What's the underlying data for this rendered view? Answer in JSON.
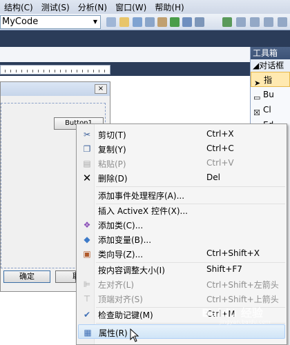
{
  "menubar": {
    "items": [
      "结构(C)",
      "测试(S)",
      "分析(N)",
      "窗口(W)",
      "帮助(H)"
    ]
  },
  "toolbar": {
    "combo_value": "MyCode"
  },
  "toolbox": {
    "title": "工具箱",
    "group": "对话框",
    "items": [
      "指",
      "Bu",
      "Cl",
      "Ed"
    ]
  },
  "dialog": {
    "button1": "Button1",
    "ok": "确定",
    "cancel": "取"
  },
  "context_menu": {
    "items": [
      {
        "label": "剪切(T)",
        "shortcut": "Ctrl+X",
        "icon": "scissors-icon",
        "disabled": false
      },
      {
        "label": "复制(Y)",
        "shortcut": "Ctrl+C",
        "icon": "copy-icon",
        "disabled": false
      },
      {
        "label": "粘贴(P)",
        "shortcut": "Ctrl+V",
        "icon": "paste-icon",
        "disabled": true
      },
      {
        "label": "删除(D)",
        "shortcut": "Del",
        "icon": "delete-icon",
        "disabled": false
      },
      {
        "label": "添加事件处理程序(A)...",
        "shortcut": "",
        "icon": "",
        "disabled": false
      },
      {
        "label": "插入 ActiveX 控件(X)...",
        "shortcut": "",
        "icon": "",
        "disabled": false
      },
      {
        "label": "添加类(C)...",
        "shortcut": "",
        "icon": "add-class-icon",
        "disabled": false
      },
      {
        "label": "添加变量(B)...",
        "shortcut": "",
        "icon": "add-variable-icon",
        "disabled": false
      },
      {
        "label": "类向导(Z)...",
        "shortcut": "Ctrl+Shift+X",
        "icon": "class-wizard-icon",
        "disabled": false
      },
      {
        "label": "按内容调整大小(I)",
        "shortcut": "Shift+F7",
        "icon": "",
        "disabled": false
      },
      {
        "label": "左对齐(L)",
        "shortcut": "Ctrl+Shift+左箭头",
        "icon": "align-left-icon",
        "disabled": true
      },
      {
        "label": "顶端对齐(S)",
        "shortcut": "Ctrl+Shift+上箭头",
        "icon": "align-top-icon",
        "disabled": true
      },
      {
        "label": "检查助记键(M)",
        "shortcut": "Ctrl+M",
        "icon": "check-mnemonic-icon",
        "disabled": false
      },
      {
        "label": "属性(R)",
        "shortcut": "",
        "icon": "properties-icon",
        "disabled": false
      }
    ]
  },
  "watermark": {
    "main": "Baidu 经验",
    "sub": "jingyan.baidu.com"
  }
}
